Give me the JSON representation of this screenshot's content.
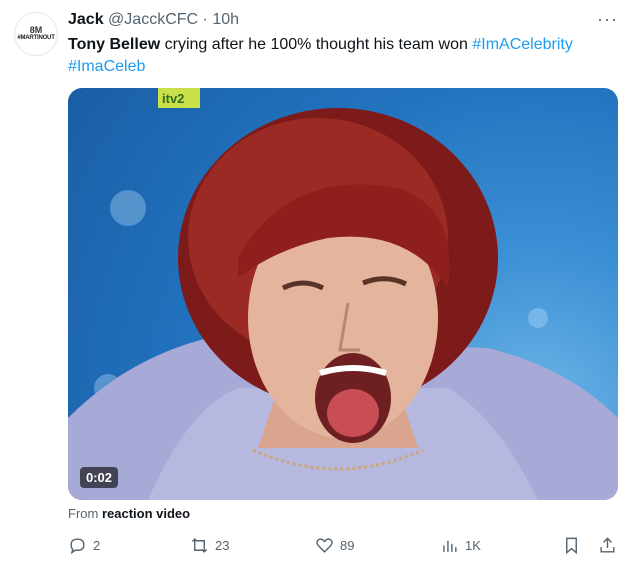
{
  "avatar": {
    "top": "8M",
    "tag": "#MARTINOUT",
    "bottom": ""
  },
  "author": {
    "name": "Jack",
    "handle": "@JacckCFC",
    "separator": "·",
    "time": "10h"
  },
  "more_label": "···",
  "tweet": {
    "bold": "Tony Bellew",
    "text": " crying after he 100% thought his team won ",
    "hashtag1": "#ImACelebrity",
    "hashtag2": "#ImaCeleb"
  },
  "media": {
    "duration": "0:02",
    "channel_logo": "itv2"
  },
  "from_line": {
    "prefix": "From ",
    "source": "reaction video"
  },
  "actions": {
    "replies": "2",
    "reposts": "23",
    "likes": "89",
    "views": "1K"
  },
  "colors": {
    "accent": "#1d9bf0",
    "secondary": "#536471",
    "text": "#0f1419"
  }
}
